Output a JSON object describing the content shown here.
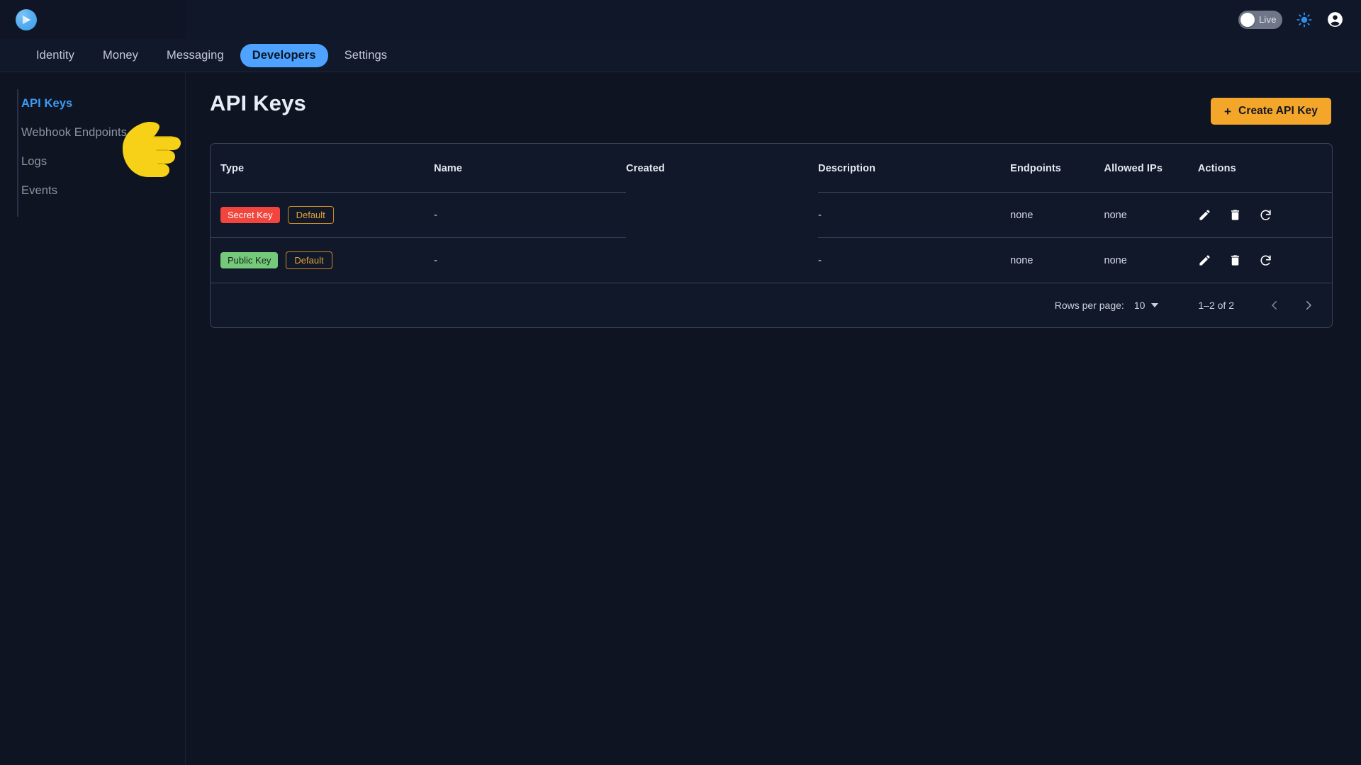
{
  "topbar": {
    "logo_icon": "app-logo-icon",
    "live_toggle": {
      "label": "Live",
      "state": "off"
    },
    "theme_icon": "brightness-sun-icon",
    "account_icon": "account-circle-icon"
  },
  "nav": {
    "tabs": [
      {
        "label": "Identity",
        "active": false
      },
      {
        "label": "Money",
        "active": false
      },
      {
        "label": "Messaging",
        "active": false
      },
      {
        "label": "Developers",
        "active": true
      },
      {
        "label": "Settings",
        "active": false
      }
    ]
  },
  "sidebar": {
    "items": [
      {
        "label": "API Keys",
        "active": true
      },
      {
        "label": "Webhook Endpoints",
        "active": false
      },
      {
        "label": "Logs",
        "active": false
      },
      {
        "label": "Events",
        "active": false
      }
    ]
  },
  "main": {
    "title": "API Keys",
    "create_button": {
      "label": "Create API Key",
      "icon": "plus-icon"
    }
  },
  "table": {
    "columns": [
      "Type",
      "Name",
      "Created",
      "Description",
      "Endpoints",
      "Allowed IPs",
      "Actions"
    ],
    "rows": [
      {
        "type_badge": "Secret Key",
        "type_badge_color": "#f2453d",
        "default_badge": "Default",
        "name": "-",
        "created": "",
        "description": "-",
        "endpoints": "none",
        "allowed_ips": "none",
        "actions": [
          "edit-icon",
          "delete-icon",
          "regenerate-icon"
        ]
      },
      {
        "type_badge": "Public Key",
        "type_badge_color": "#74c97a",
        "default_badge": "Default",
        "name": "-",
        "created": "",
        "description": "-",
        "endpoints": "none",
        "allowed_ips": "none",
        "actions": [
          "edit-icon",
          "delete-icon",
          "regenerate-icon"
        ]
      }
    ]
  },
  "pagination": {
    "rows_per_page_label": "Rows per page:",
    "rows_per_page_value": "10",
    "range": "1–2 of 2",
    "prev_icon": "chevron-left-icon",
    "next_icon": "chevron-right-icon"
  },
  "cursor": {
    "icon": "pointing-hand-right-emoji",
    "glyph": "👉"
  },
  "colors": {
    "background": "#0e1422",
    "panel": "#111829",
    "accent_blue": "#4da3ff",
    "accent_orange": "#f4a62a",
    "secret_red": "#f2453d",
    "public_green": "#74c97a",
    "default_gold": "#e0a43a",
    "border": "#3a4257"
  }
}
